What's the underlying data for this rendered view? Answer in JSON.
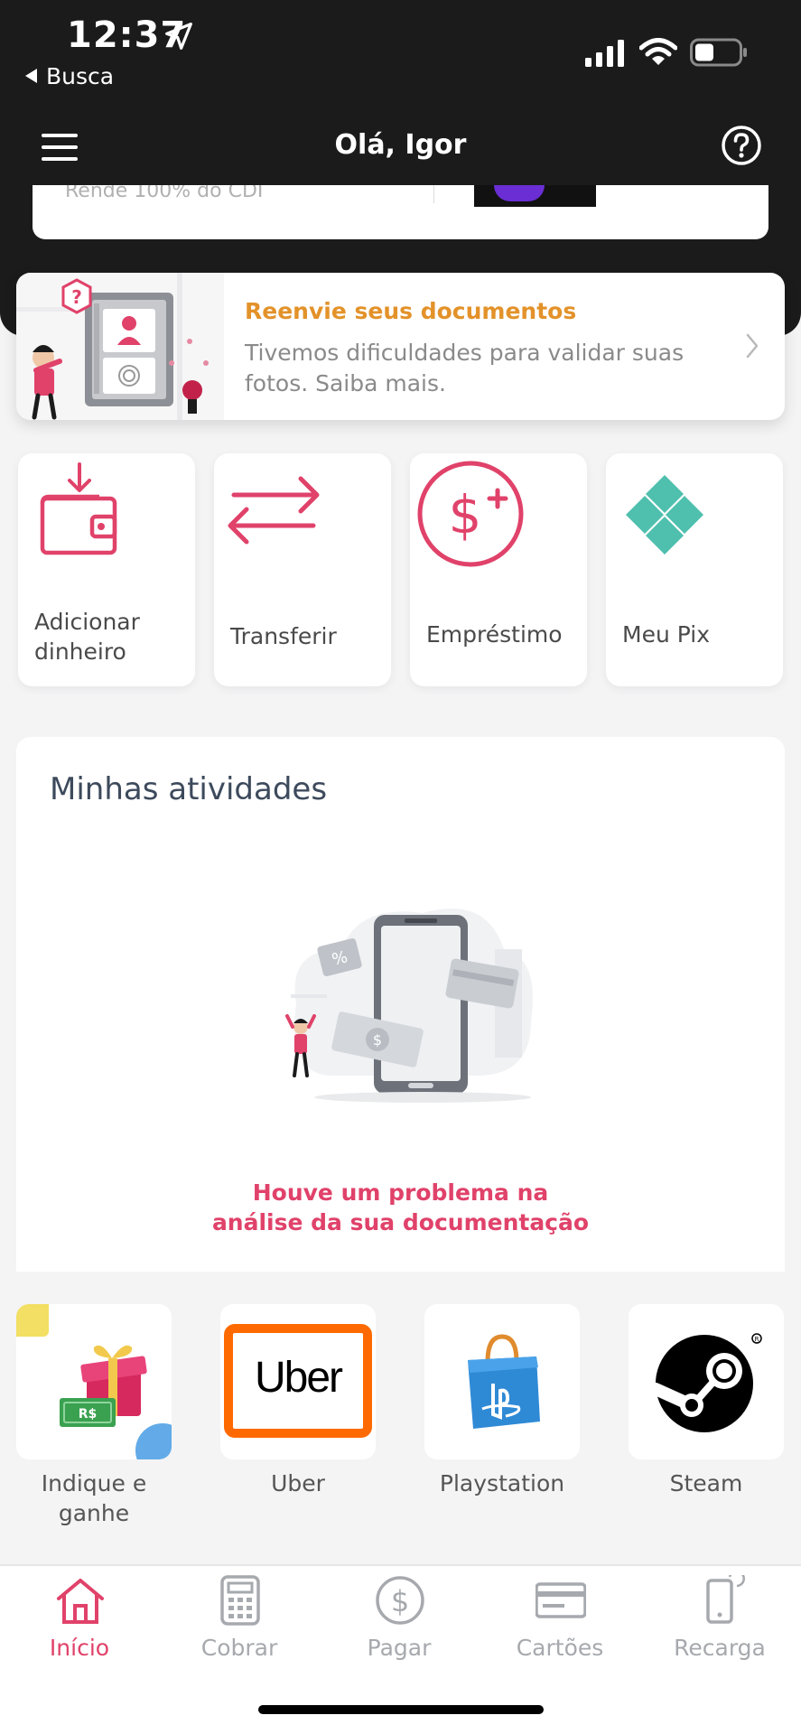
{
  "status": {
    "time": "12:37",
    "back_app": "Busca"
  },
  "header": {
    "title": "Olá, Igor"
  },
  "peek": {
    "text": "Rende 100% do CDI"
  },
  "banner": {
    "title": "Reenvie seus documentos",
    "text": "Tivemos dificuldades para validar suas fotos. Saiba mais."
  },
  "actions": [
    {
      "label": "Adicionar dinheiro",
      "icon": "wallet-add-icon"
    },
    {
      "label": "Transferir",
      "icon": "transfer-arrows-icon"
    },
    {
      "label": "Empréstimo",
      "icon": "loan-dollar-plus-icon"
    },
    {
      "label": "Meu Pix",
      "icon": "pix-icon"
    }
  ],
  "activities": {
    "title": "Minhas atividades",
    "message_line1": "Houve um problema na",
    "message_line2": "análise da sua documentação"
  },
  "partners": [
    {
      "label": "Indique e ganhe",
      "icon": "gift-money-icon",
      "badge": "R$"
    },
    {
      "label": "Uber",
      "icon": "uber-logo",
      "logo_text": "Uber"
    },
    {
      "label": "Playstation",
      "icon": "playstation-bag-icon"
    },
    {
      "label": "Steam",
      "icon": "steam-logo"
    }
  ],
  "nav": [
    {
      "label": "Início",
      "icon": "home-icon",
      "active": true
    },
    {
      "label": "Cobrar",
      "icon": "calculator-icon"
    },
    {
      "label": "Pagar",
      "icon": "dollar-circle-icon"
    },
    {
      "label": "Cartões",
      "icon": "card-icon"
    },
    {
      "label": "Recarga",
      "icon": "phone-recharge-icon"
    }
  ],
  "colors": {
    "accent": "#e0426a",
    "warning": "#e3922a",
    "dark": "#1b1b1c",
    "pix": "#4fbfae",
    "uber_orange": "#ff6a00",
    "playstation_blue": "#2f8ad6"
  }
}
